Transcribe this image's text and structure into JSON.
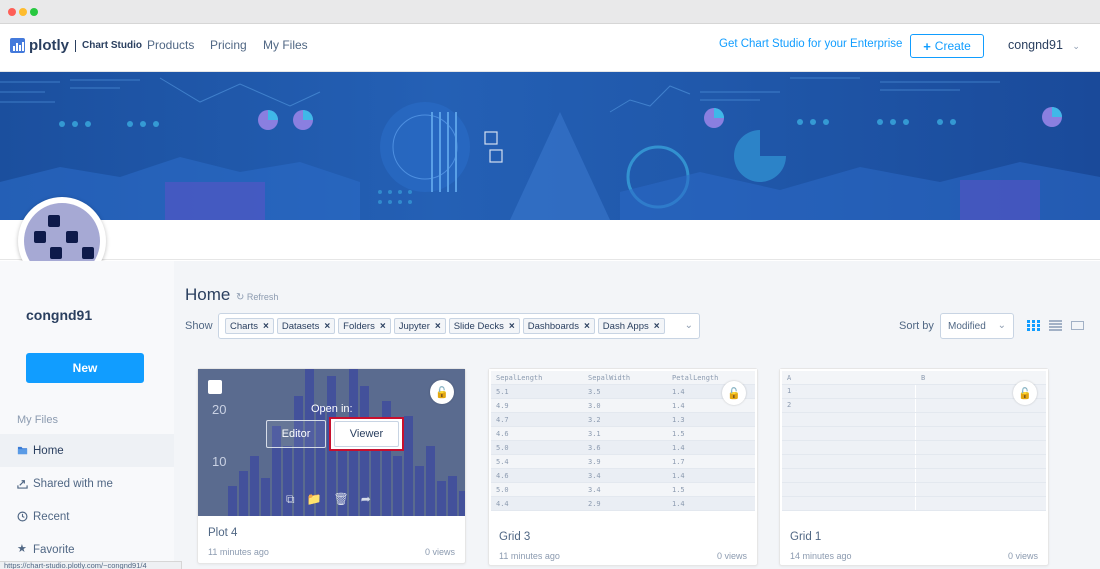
{
  "nav": {
    "brand": "plotly",
    "brand_sub": "Chart Studio",
    "links": [
      "Products",
      "Pricing",
      "My Files"
    ],
    "enterprise_link": "Get Chart Studio for your Enterprise",
    "create_label": "Create",
    "username": "congnd91"
  },
  "profile": {
    "username": "congnd91"
  },
  "sidebar": {
    "new_label": "New",
    "section_label": "My Files",
    "items": [
      {
        "label": "Home",
        "icon": "folder-icon",
        "active": true
      },
      {
        "label": "Shared with me",
        "icon": "share-icon",
        "active": false
      },
      {
        "label": "Recent",
        "icon": "clock-icon",
        "active": false
      },
      {
        "label": "Favorite",
        "icon": "star-icon",
        "active": false
      }
    ]
  },
  "main": {
    "title": "Home",
    "refresh_label": "Refresh",
    "show_label": "Show",
    "filters": [
      "Charts",
      "Datasets",
      "Folders",
      "Jupyter",
      "Slide Decks",
      "Dashboards",
      "Dash Apps"
    ],
    "sort_label": "Sort by",
    "sort_value": "Modified"
  },
  "cards": [
    {
      "title": "Plot 4",
      "time": "11 minutes ago",
      "views": "0 views",
      "open_in_label": "Open in:",
      "editor_label": "Editor",
      "viewer_label": "Viewer",
      "y_ticks": [
        "20",
        "10"
      ]
    },
    {
      "title": "Grid 3",
      "time": "11 minutes ago",
      "views": "0 views",
      "columns": [
        "SepalLength",
        "SepalWidth",
        "PetalLength"
      ],
      "rows": [
        [
          "5.1",
          "3.5",
          "1.4"
        ],
        [
          "4.9",
          "3.0",
          "1.4"
        ],
        [
          "4.7",
          "3.2",
          "1.3"
        ],
        [
          "4.6",
          "3.1",
          "1.5"
        ],
        [
          "5.0",
          "3.6",
          "1.4"
        ],
        [
          "5.4",
          "3.9",
          "1.7"
        ],
        [
          "4.6",
          "3.4",
          "1.4"
        ],
        [
          "5.0",
          "3.4",
          "1.5"
        ],
        [
          "4.4",
          "2.9",
          "1.4"
        ]
      ]
    },
    {
      "title": "Grid 1",
      "time": "14 minutes ago",
      "views": "0 views",
      "columns": [
        "A",
        "B"
      ],
      "rows": [
        [
          "1",
          ""
        ],
        [
          "2",
          ""
        ]
      ]
    }
  ],
  "statusbar": {
    "url": "https://chart-studio.plotly.com/~congnd91/4"
  },
  "colors": {
    "accent": "#119dff",
    "banner": "#1f56a8",
    "highlight": "#c8102e"
  }
}
